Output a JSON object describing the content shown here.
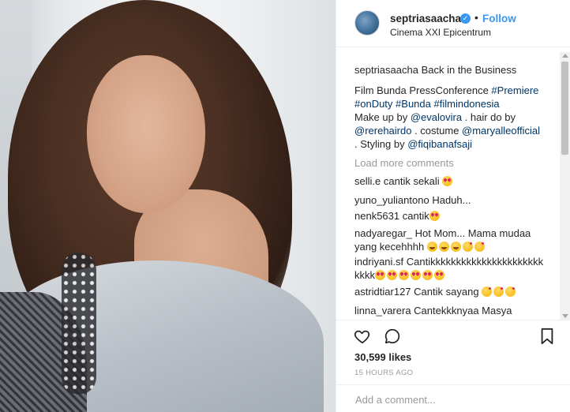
{
  "post": {
    "username": "septriasaacha",
    "verified_icon": "✓",
    "separator": "•",
    "follow_label": "Follow",
    "location": "Cinema XXI Epicentrum"
  },
  "caption": {
    "username": "septriasaacha",
    "line1": "Back in the Business",
    "text_a": "Film Bunda PressConference ",
    "tag_premiere": "#Premiere",
    "tag_onduty": "#onDuty",
    "tag_bunda": "#Bunda",
    "tag_filmindonesia": "#filmindonesia",
    "text_makeup": "Make up by ",
    "mention_evalovira": "@evalovira",
    "text_hair": " . hair do by",
    "mention_rerehairdo": "@rerehairdo",
    "text_costume": " . costume ",
    "mention_maryalle": "@maryalleofficial",
    "text_styling": ". Styling by ",
    "mention_fiqi": "@fiqibanafsaji"
  },
  "load_more_label": "Load more comments",
  "comments": [
    {
      "user": "selli.e",
      "text": "cantik sekali"
    },
    {
      "user": "yuno_yuliantono",
      "text": "Haduh..."
    },
    {
      "user": "nenk5631",
      "text": "cantik"
    },
    {
      "user": "nadyaregar_",
      "text": "Hot Mom... Mama mudaa yang kecehhhh"
    },
    {
      "user": "indriyani.sf",
      "text": "Cantikkkkkkkkkkkkkkkkkkkkkkkkkk"
    },
    {
      "user": "astridtiar127",
      "text": "Cantik sayang"
    },
    {
      "user": "linna_varera",
      "text": "Cantekkknyaa Masya"
    }
  ],
  "icons": {
    "like": "heart-icon",
    "comment": "comment-icon",
    "save": "bookmark-icon"
  },
  "likes_label": "30,599 likes",
  "time_ago": "15 HOURS AGO",
  "add_comment_placeholder": "Add a comment...",
  "colors": {
    "accent": "#3897f0",
    "hashtag": "#003569",
    "muted": "#999999",
    "text": "#262626"
  }
}
